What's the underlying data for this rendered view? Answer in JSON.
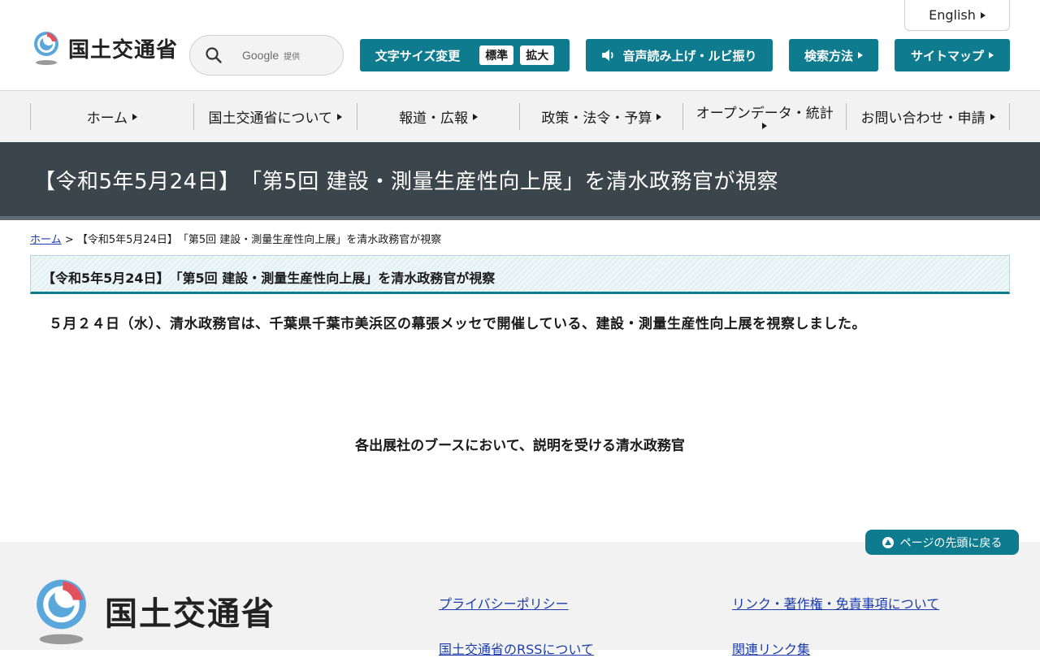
{
  "header": {
    "logo_text": "国土交通省",
    "english": "English",
    "search": {
      "brand": "Google",
      "brand_sub": "提供"
    },
    "font_size": {
      "label": "文字サイズ変更",
      "standard": "標準",
      "large": "拡大"
    },
    "voice": "音声読み上げ・ルビ振り",
    "search_method": "検索方法",
    "sitemap": "サイトマップ"
  },
  "nav": {
    "items": [
      {
        "label": "ホーム"
      },
      {
        "label": "国土交通省について"
      },
      {
        "label": "報道・広報"
      },
      {
        "label": "政策・法令・予算"
      },
      {
        "label": "オープンデータ・統計"
      },
      {
        "label": "お問い合わせ・申請"
      }
    ]
  },
  "page": {
    "title": "【令和5年5月24日】　「第5回 建設・測量生産性向上展」を清水政務官が視察",
    "breadcrumb_home": "ホーム",
    "breadcrumb_sep": ">",
    "breadcrumb_current": "【令和5年5月24日】　「第5回 建設・測量生産性向上展」を清水政務官が視察",
    "section_heading": "【令和5年5月24日】　「第5回 建設・測量生産性向上展」を清水政務官が視察",
    "body": "５月２４日（水）、清水政務官は、千葉県千葉市美浜区の幕張メッセで開催している、建設・測量生産性向上展を視察しました。",
    "caption": "各出展社のブースにおいて、説明を受ける清水政務官"
  },
  "footer": {
    "to_top": "ページの先頭に戻る",
    "logo_text": "国土交通省",
    "links": [
      "プライバシーポリシー",
      "リンク・著作権・免責事項について",
      "国土交通省のRSSについて",
      "関連リンク集"
    ]
  },
  "colors": {
    "accent": "#0f7b8f",
    "title_band": "#3a464b",
    "link": "#1a3cad"
  }
}
